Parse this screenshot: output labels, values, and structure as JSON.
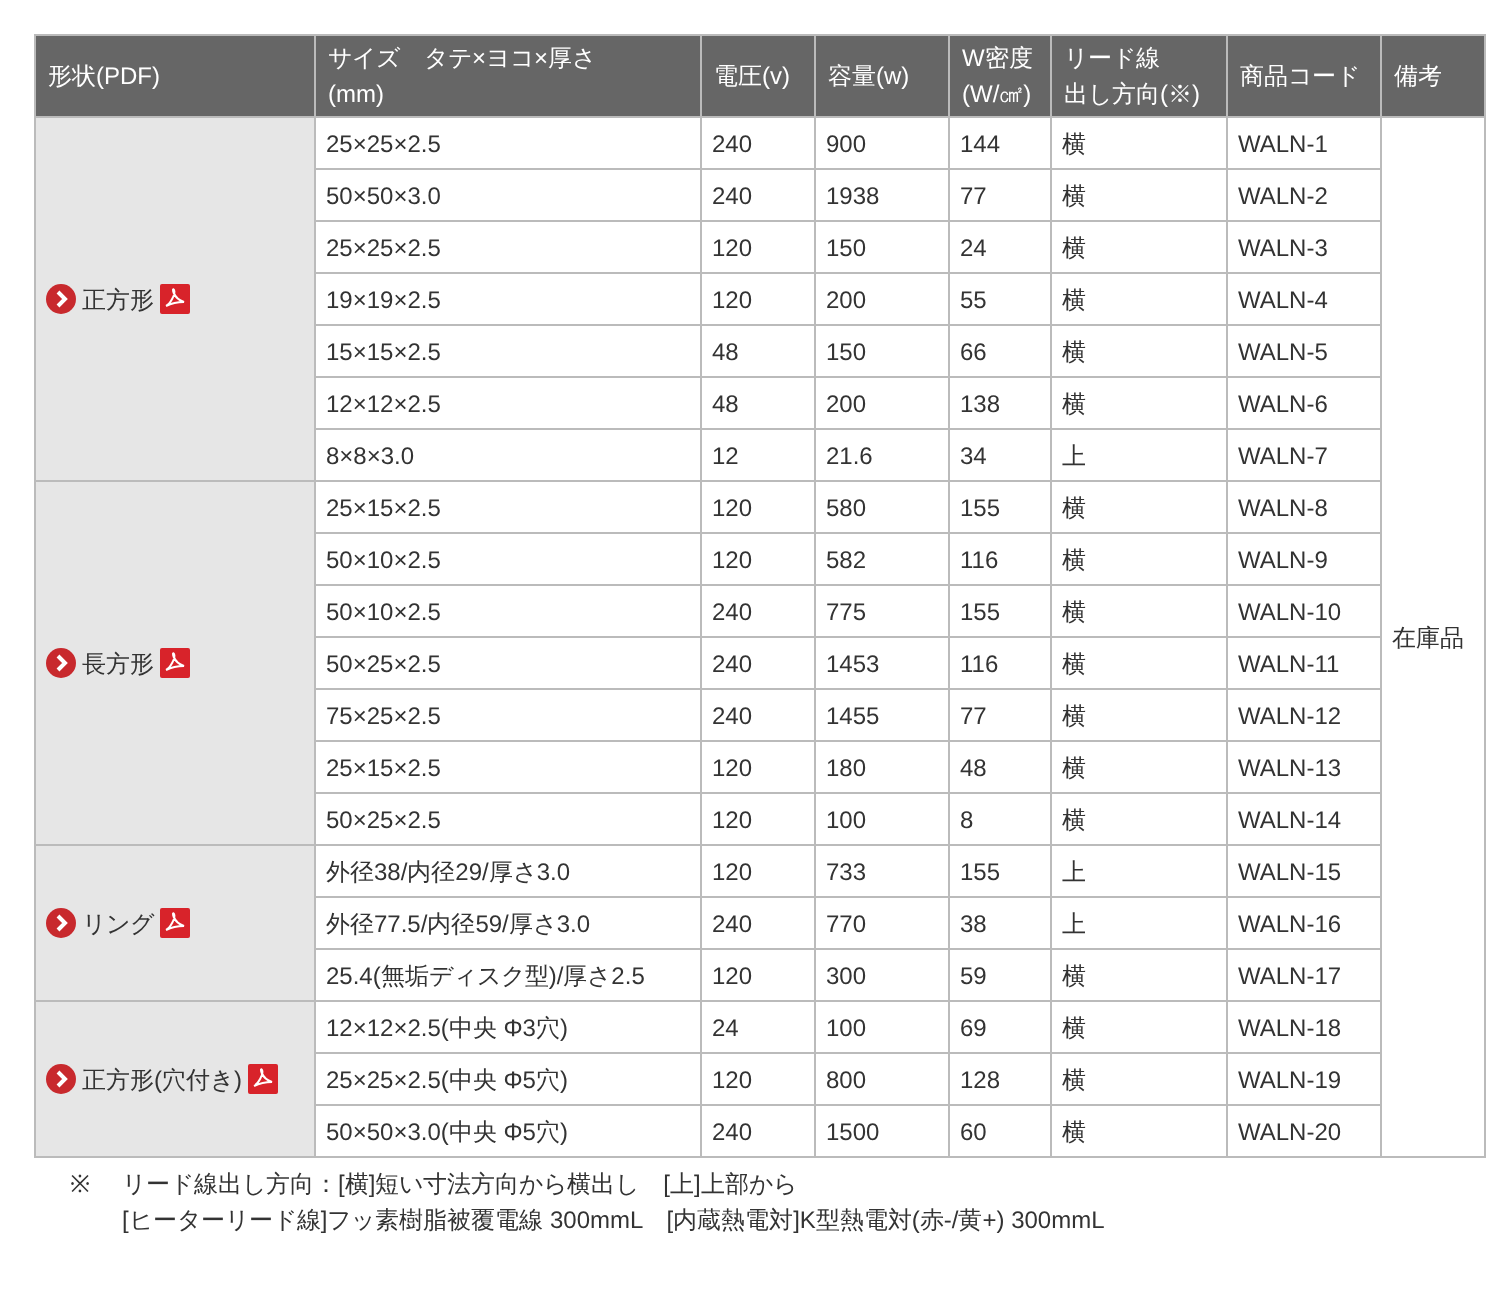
{
  "table": {
    "columns": [
      [
        "形状(PDF)"
      ],
      [
        "サイズ　タテ×ヨコ×厚さ",
        "(mm)"
      ],
      [
        "電圧(v)"
      ],
      [
        "容量(w)"
      ],
      [
        "W密度",
        "(W/㎠)"
      ],
      [
        "リード線",
        "出し方向(※)"
      ],
      [
        "商品コード"
      ],
      [
        "備考"
      ]
    ],
    "remarks": "在庫品",
    "groups": [
      {
        "shape": "正方形",
        "rows": [
          {
            "size": "25×25×2.5",
            "voltage": "240",
            "capacity": "900",
            "density": "144",
            "lead": "横",
            "code": "WALN-1"
          },
          {
            "size": "50×50×3.0",
            "voltage": "240",
            "capacity": "1938",
            "density": "77",
            "lead": "横",
            "code": "WALN-2"
          },
          {
            "size": "25×25×2.5",
            "voltage": "120",
            "capacity": "150",
            "density": "24",
            "lead": "横",
            "code": "WALN-3"
          },
          {
            "size": "19×19×2.5",
            "voltage": "120",
            "capacity": "200",
            "density": "55",
            "lead": "横",
            "code": "WALN-4"
          },
          {
            "size": "15×15×2.5",
            "voltage": "48",
            "capacity": "150",
            "density": "66",
            "lead": "横",
            "code": "WALN-5"
          },
          {
            "size": "12×12×2.5",
            "voltage": "48",
            "capacity": "200",
            "density": "138",
            "lead": "横",
            "code": "WALN-6"
          },
          {
            "size": "8×8×3.0",
            "voltage": "12",
            "capacity": "21.6",
            "density": "34",
            "lead": "上",
            "code": "WALN-7"
          }
        ]
      },
      {
        "shape": "長方形",
        "rows": [
          {
            "size": "25×15×2.5",
            "voltage": "120",
            "capacity": "580",
            "density": "155",
            "lead": "横",
            "code": "WALN-8"
          },
          {
            "size": "50×10×2.5",
            "voltage": "120",
            "capacity": "582",
            "density": "116",
            "lead": "横",
            "code": "WALN-9"
          },
          {
            "size": "50×10×2.5",
            "voltage": "240",
            "capacity": "775",
            "density": "155",
            "lead": "横",
            "code": "WALN-10"
          },
          {
            "size": "50×25×2.5",
            "voltage": "240",
            "capacity": "1453",
            "density": "116",
            "lead": "横",
            "code": "WALN-11"
          },
          {
            "size": "75×25×2.5",
            "voltage": "240",
            "capacity": "1455",
            "density": "77",
            "lead": "横",
            "code": "WALN-12"
          },
          {
            "size": "25×15×2.5",
            "voltage": "120",
            "capacity": "180",
            "density": "48",
            "lead": "横",
            "code": "WALN-13"
          },
          {
            "size": "50×25×2.5",
            "voltage": "120",
            "capacity": "100",
            "density": "8",
            "lead": "横",
            "code": "WALN-14"
          }
        ]
      },
      {
        "shape": "リング",
        "rows": [
          {
            "size": "外径38/内径29/厚さ3.0",
            "voltage": "120",
            "capacity": "733",
            "density": "155",
            "lead": "上",
            "code": "WALN-15"
          },
          {
            "size": "外径77.5/内径59/厚さ3.0",
            "voltage": "240",
            "capacity": "770",
            "density": "38",
            "lead": "上",
            "code": "WALN-16"
          },
          {
            "size": "25.4(無垢ディスク型)/厚さ2.5",
            "voltage": "120",
            "capacity": "300",
            "density": "59",
            "lead": "横",
            "code": "WALN-17"
          }
        ]
      },
      {
        "shape": "正方形(穴付き)",
        "rows": [
          {
            "size": "12×12×2.5(中央 Φ3穴)",
            "voltage": "24",
            "capacity": "100",
            "density": "69",
            "lead": "横",
            "code": "WALN-18"
          },
          {
            "size": "25×25×2.5(中央 Φ5穴)",
            "voltage": "120",
            "capacity": "800",
            "density": "128",
            "lead": "横",
            "code": "WALN-19"
          },
          {
            "size": "50×50×3.0(中央 Φ5穴)",
            "voltage": "240",
            "capacity": "1500",
            "density": "60",
            "lead": "横",
            "code": "WALN-20"
          }
        ]
      }
    ]
  },
  "notes": {
    "mark": "※",
    "lines": [
      "リード線出し方向：[横]短い寸法方向から横出し　[上]上部から",
      "[ヒーターリード線]フッ素樹脂被覆電線 300mmL　[内蔵熱電対]K型熱電対(赤-/黄+) 300mmL"
    ]
  }
}
